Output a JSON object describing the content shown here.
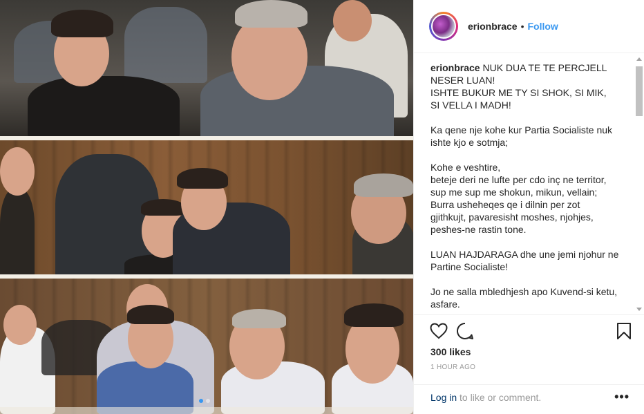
{
  "post": {
    "image_alt_icons": [
      "photo-collage"
    ],
    "carousel": {
      "count": 3,
      "active": 0
    }
  },
  "header": {
    "username": "erionbrace",
    "separator": "•",
    "follow_label": "Follow"
  },
  "caption": {
    "username": "erionbrace",
    "paragraphs": [
      "NUK DUA TE TE PERCJELL\nNESER LUAN!\nISHTE BUKUR ME TY SI SHOK, SI MIK,\nSI VELLA I MADH!",
      "Ka qene nje kohe kur Partia Socialiste nuk\nishte kjo e sotmja;",
      "Kohe e veshtire,\nbeteje deri ne lufte per cdo inç ne territor,\nsup me sup me shokun, mikun, vellain;\nBurra usheheqes qe i dilnin per zot\ngjithkujt, pavaresisht moshes, njohjes,\npeshes-ne rastin tone.",
      "LUAN HAJDARAGA dhe une jemi njohur ne\nPartine Socialiste!",
      "Jo ne salla mbledhjesh apo Kuvend-si ketu,\nasfare."
    ]
  },
  "actions": {
    "like_icon": "heart-icon",
    "comment_icon": "comment-icon",
    "save_icon": "bookmark-icon",
    "likes_text": "300 likes",
    "time_text": "1 HOUR AGO"
  },
  "comment_bar": {
    "login_link": "Log in",
    "login_rest": " to like or comment.",
    "more_label": "•••"
  },
  "colors": {
    "link_blue": "#3897f0",
    "muted": "#999999",
    "text": "#262626",
    "login_link": "#003569"
  }
}
